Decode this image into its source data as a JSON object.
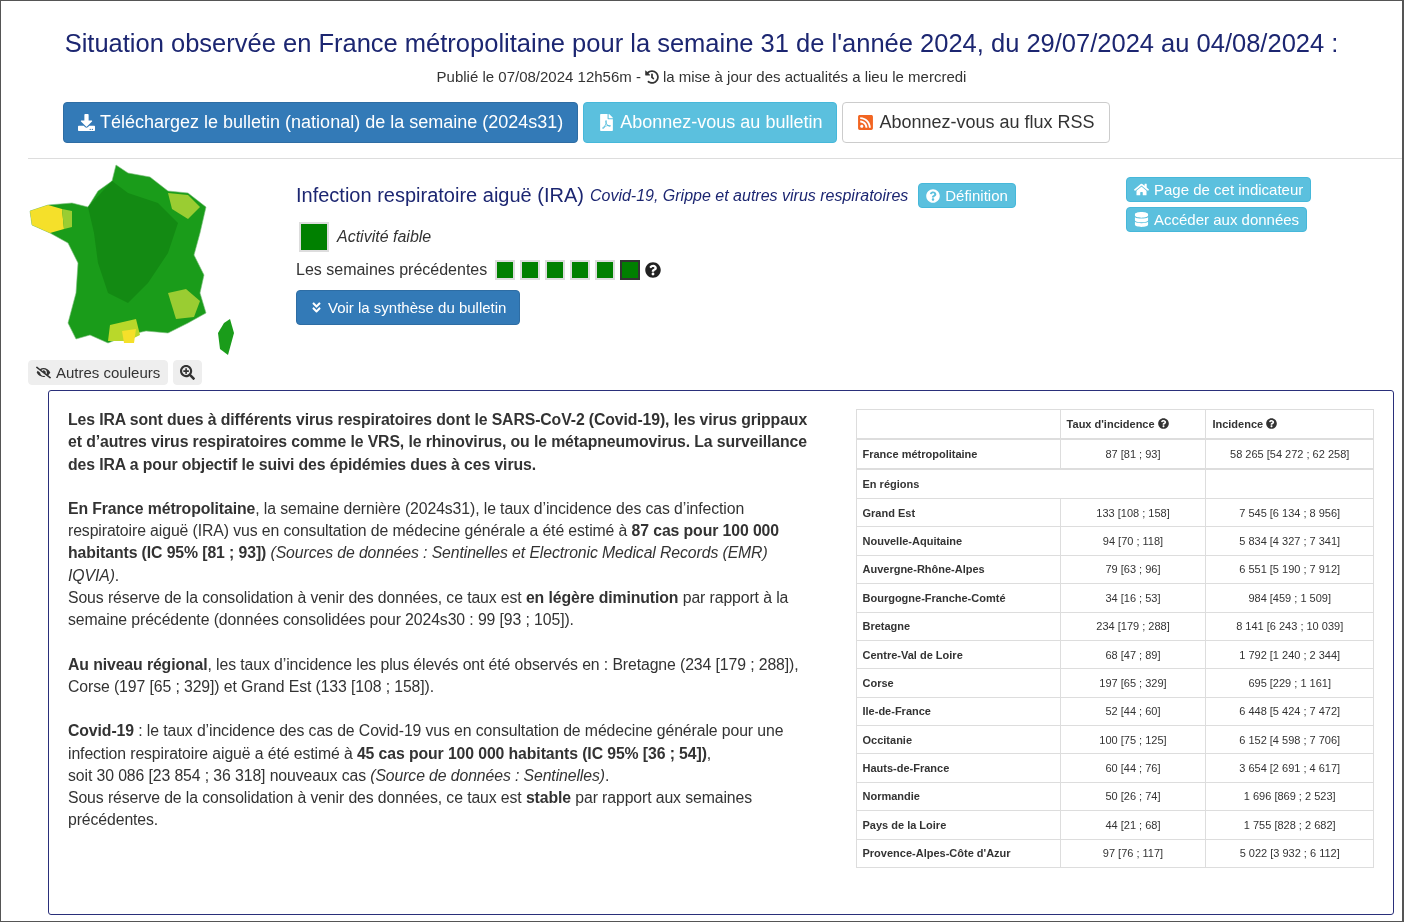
{
  "title": "Situation observée en France métropolitaine pour la semaine 31 de l'année 2024, du 29/07/2024 au 04/08/2024 :",
  "published": "Publié le 07/08/2024 12h56m -",
  "update_note": "la mise à jour des actualités a lieu le mercredi",
  "top_buttons": [
    {
      "kind": "download",
      "label": "Téléchargez le bulletin (national) de la semaine (2024s31)"
    },
    {
      "kind": "pdf",
      "label": "Abonnez-vous au bulletin"
    },
    {
      "kind": "rss",
      "label": "Abonnez-vous au flux RSS"
    }
  ],
  "map_buttons": [
    {
      "kind": "colors",
      "label": "Autres couleurs"
    },
    {
      "kind": "zoom"
    }
  ],
  "indicator": {
    "name": "Infection respiratoire aiguë (IRA)",
    "subtitle": "Covid-19, Grippe et autres virus respiratoires",
    "definition_button": "Définition",
    "activity": {
      "color": "#008000",
      "label": "Activité faible"
    },
    "previous_weeks_label": "Les semaines précédentes",
    "previous_weeks": [
      {
        "color": "#008000",
        "selected": false
      },
      {
        "color": "#008000",
        "selected": false
      },
      {
        "color": "#008000",
        "selected": false
      },
      {
        "color": "#008000",
        "selected": false
      },
      {
        "color": "#008000",
        "selected": false
      },
      {
        "color": "#008000",
        "selected": true
      }
    ],
    "summary_button": "Voir la synthèse du bulletin"
  },
  "side_buttons": [
    {
      "kind": "page",
      "label": "Page de cet indicateur"
    },
    {
      "kind": "data",
      "label": "Accéder aux données"
    }
  ],
  "paragraphs": [
    {
      "kind": "lead",
      "lines": [
        "Les IRA sont dues à différents virus respiratoires dont le SARS-CoV-2 (Covid-19), les virus grippaux et d’autres virus respiratoires comme le VRS, le rhinovirus, ou le métapneumovirus. La surveillance des IRA a pour objectif le suivi des épidémies dues à ces virus."
      ]
    },
    {
      "kind": "body",
      "lines": [
        "**En France métropolitaine**, la semaine dernière (2024s31), le taux d’incidence des cas d’infection respiratoire aiguë (IRA) vus en consultation de médecine générale a été estimé à **87 cas pour 100 000 habitants (IC 95% [81 ; 93])** *(Sources de données : Sentinelles et Electronic Medical Records (EMR) IQVIA)*.",
        "Sous réserve de la consolidation à venir des données, ce taux est **en légère diminution** par rapport à la semaine précédente (données consolidées pour 2024s30 : 99 [93 ; 105])."
      ]
    },
    {
      "kind": "body",
      "lines": [
        "**Au niveau régional**, les taux d’incidence les plus élevés ont été observés en : Bretagne (234 [179 ; 288]), Corse (197 [65 ; 329]) et Grand Est (133 [108 ; 158])."
      ]
    },
    {
      "kind": "body",
      "lines": [
        "**Covid-19** : le taux d’incidence des cas de Covid-19 vus en consultation de médecine générale pour une infection respiratoire aiguë a été estimé à **45 cas pour 100 000 habitants** **(IC 95% [36 ; 54])**,",
        "soit 30 086 [23 854 ; 36 318] nouveaux cas *(Source de données : Sentinelles)*.",
        "Sous réserve de la consolidation à venir des données, ce taux est **stable** par rapport aux semaines précédentes."
      ]
    }
  ],
  "table": {
    "columns": [
      "Taux d'incidence",
      "Incidence"
    ],
    "rows": [
      {
        "kind": "data",
        "name": "France métropolitaine",
        "rate": "87 [81 ; 93]",
        "count": "58 265 [54 272 ; 62 258]"
      },
      {
        "kind": "section",
        "name": "En régions"
      },
      {
        "kind": "data",
        "name": "Grand Est",
        "rate": "133 [108 ; 158]",
        "count": "7 545 [6 134 ; 8 956]"
      },
      {
        "kind": "data",
        "name": "Nouvelle-Aquitaine",
        "rate": "94 [70 ; 118]",
        "count": "5 834 [4 327 ; 7 341]"
      },
      {
        "kind": "data",
        "name": "Auvergne-Rhône-Alpes",
        "rate": "79 [63 ; 96]",
        "count": "6 551 [5 190 ; 7 912]"
      },
      {
        "kind": "data",
        "name": "Bourgogne-Franche-Comté",
        "rate": "34 [16 ; 53]",
        "count": "984 [459 ; 1 509]"
      },
      {
        "kind": "data",
        "name": "Bretagne",
        "rate": "234 [179 ; 288]",
        "count": "8 141 [6 243 ; 10 039]"
      },
      {
        "kind": "data",
        "name": "Centre-Val de Loire",
        "rate": "68 [47 ; 89]",
        "count": "1 792 [1 240 ; 2 344]"
      },
      {
        "kind": "data",
        "name": "Corse",
        "rate": "197 [65 ; 329]",
        "count": "695 [229 ; 1 161]"
      },
      {
        "kind": "data",
        "name": "Ile-de-France",
        "rate": "52 [44 ; 60]",
        "count": "6 448 [5 424 ; 7 472]"
      },
      {
        "kind": "data",
        "name": "Occitanie",
        "rate": "100 [75 ; 125]",
        "count": "6 152 [4 598 ; 7 706]"
      },
      {
        "kind": "data",
        "name": "Hauts-de-France",
        "rate": "60 [44 ; 76]",
        "count": "3 654 [2 691 ; 4 617]"
      },
      {
        "kind": "data",
        "name": "Normandie",
        "rate": "50 [26 ; 74]",
        "count": "1 696 [869 ; 2 523]"
      },
      {
        "kind": "data",
        "name": "Pays de la Loire",
        "rate": "44 [21 ; 68]",
        "count": "1 755 [828 ; 2 682]"
      },
      {
        "kind": "data",
        "name": "Provence-Alpes-Côte d'Azur",
        "rate": "97 [76 ; 117]",
        "count": "5 022 [3 932 ; 6 112]"
      }
    ]
  }
}
